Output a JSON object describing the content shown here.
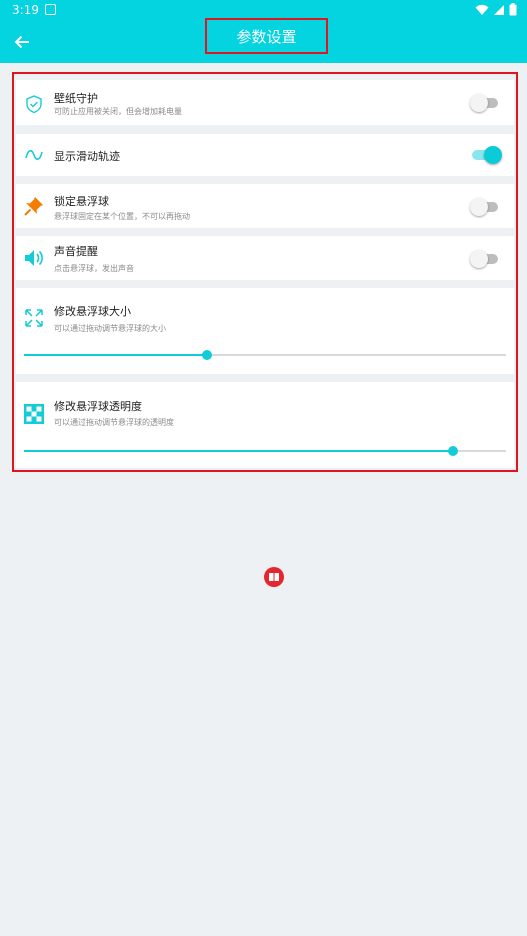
{
  "status_bar": {
    "time": "3:19"
  },
  "app_bar": {
    "title": "参数设置"
  },
  "settings": {
    "wallpaper_guard": {
      "title": "壁纸守护",
      "subtitle": "可防止应用被关闭，但会增加耗电量",
      "enabled": false
    },
    "show_trail": {
      "title": "显示滑动轨迹",
      "enabled": true
    },
    "lock_ball": {
      "title": "锁定悬浮球",
      "subtitle": "悬浮球固定在某个位置，不可以再拖动",
      "enabled": false
    },
    "sound": {
      "title": "声音提醒",
      "subtitle": "点击悬浮球，发出声音",
      "enabled": false
    },
    "ball_size": {
      "title": "修改悬浮球大小",
      "subtitle": "可以通过拖动调节悬浮球的大小",
      "value": 0.38
    },
    "ball_opacity": {
      "title": "修改悬浮球透明度",
      "subtitle": "可以通过拖动调节悬浮球的透明度",
      "value": 0.89
    }
  },
  "colors": {
    "accent": "#04d3e0",
    "highlight": "#e0161e",
    "pin": "#f57c00",
    "ball": "#e5262e"
  }
}
